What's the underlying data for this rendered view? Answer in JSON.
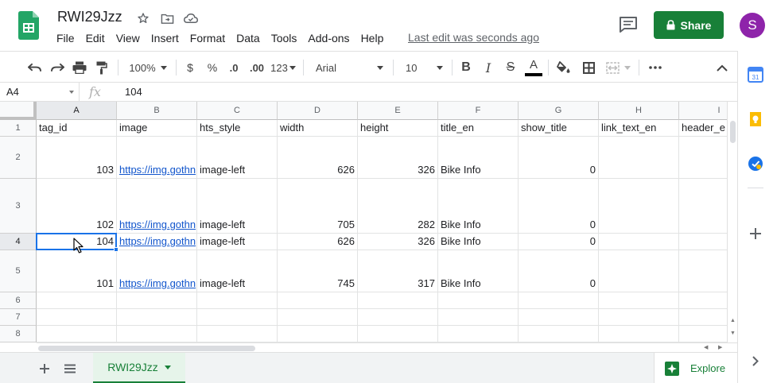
{
  "app": {
    "title": "RWI29Jzz",
    "last_edit": "Last edit was seconds ago",
    "share_label": "Share",
    "avatar_initial": "S",
    "colors": {
      "brand_green": "#188038",
      "avatar_purple": "#8e24aa",
      "selection_blue": "#1a73e8",
      "link_blue": "#1155cc"
    }
  },
  "menu": [
    "File",
    "Edit",
    "View",
    "Insert",
    "Format",
    "Data",
    "Tools",
    "Add-ons",
    "Help"
  ],
  "toolbar": {
    "zoom": "100%",
    "currency": "$",
    "percent": "%",
    "decrease_decimals": ".0",
    "increase_decimals": ".00",
    "more_formats": "123",
    "font": "Arial",
    "font_size": "10",
    "icons": [
      "undo-icon",
      "redo-icon",
      "print-icon",
      "paint-format-icon",
      "bold-icon",
      "italic-icon",
      "strikethrough-icon",
      "text-color-icon",
      "fill-color-icon",
      "borders-icon",
      "merge-cells-icon",
      "more-icon",
      "collapse-icon"
    ]
  },
  "formula_bar": {
    "cell_ref": "A4",
    "fx": "fx",
    "value": "104"
  },
  "grid": {
    "columns": [
      "A",
      "B",
      "C",
      "D",
      "E",
      "F",
      "G",
      "H",
      "I"
    ],
    "rows": [
      {
        "num": "1",
        "cells": [
          "tag_id",
          "image",
          "hts_style",
          "width",
          "height",
          "title_en",
          "show_title",
          "link_text_en",
          "header_e"
        ]
      },
      {
        "num": "2",
        "cells": [
          "103",
          "https://img.gothn",
          "image-left",
          "626",
          "326",
          "Bike Info",
          "0",
          "",
          ""
        ]
      },
      {
        "num": "3",
        "cells": [
          "102",
          "https://img.gothn",
          "image-left",
          "705",
          "282",
          "Bike Info",
          "0",
          "",
          ""
        ]
      },
      {
        "num": "4",
        "cells": [
          "104",
          "https://img.gothn",
          "image-left",
          "626",
          "326",
          "Bike Info",
          "0",
          "",
          ""
        ]
      },
      {
        "num": "5",
        "cells": [
          "101",
          "https://img.gothn",
          "image-left",
          "745",
          "317",
          "Bike Info",
          "0",
          "",
          ""
        ]
      },
      {
        "num": "6",
        "cells": [
          "",
          "",
          "",
          "",
          "",
          "",
          "",
          "",
          ""
        ]
      },
      {
        "num": "7",
        "cells": [
          "",
          "",
          "",
          "",
          "",
          "",
          "",
          "",
          ""
        ]
      },
      {
        "num": "8",
        "cells": [
          "",
          "",
          "",
          "",
          "",
          "",
          "",
          "",
          ""
        ]
      }
    ],
    "selected_cell": "A4"
  },
  "bottom": {
    "sheet_tab": "RWI29Jzz",
    "explore_label": "Explore",
    "icons": [
      "add-sheet-icon",
      "all-sheets-icon"
    ]
  },
  "side_panel": {
    "icons": [
      "calendar-icon",
      "keep-icon",
      "tasks-icon",
      "add-addon-icon",
      "expand-panel-icon"
    ],
    "calendar_day": "31"
  }
}
